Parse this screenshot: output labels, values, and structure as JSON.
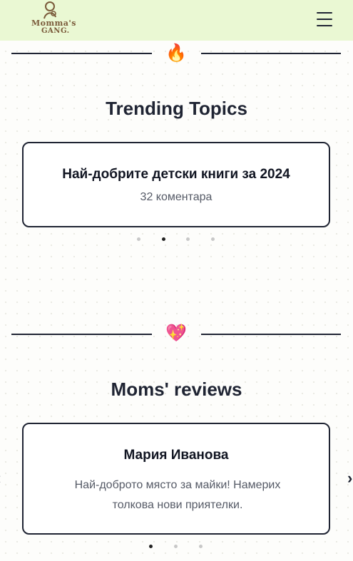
{
  "header": {
    "logo_line1": "Momma's",
    "logo_line2": "GANG.",
    "menu_icon": "hamburger-menu-icon"
  },
  "trending": {
    "divider_emoji": "🔥",
    "title": "Trending Topics",
    "card_title": "Най-добрите детски книги за 2024",
    "card_subtitle": "32 коментара",
    "dots": {
      "count": 4,
      "active_index": 1
    }
  },
  "reviews": {
    "divider_emoji": "💖",
    "title": "Moms' reviews",
    "reviewer_name": "Мария Иванова",
    "review_line1": "Най-доброто място за майки! Намерих",
    "review_line2": "толкова нови приятелки.",
    "dots": {
      "count": 3,
      "active_index": 0
    },
    "prev_label": "‹",
    "next_label": "›"
  },
  "colors": {
    "header_bg": "#eaf8d3",
    "text_dark": "#1f2433",
    "text_muted": "#555a66",
    "logo_brown": "#7a5a3a"
  }
}
